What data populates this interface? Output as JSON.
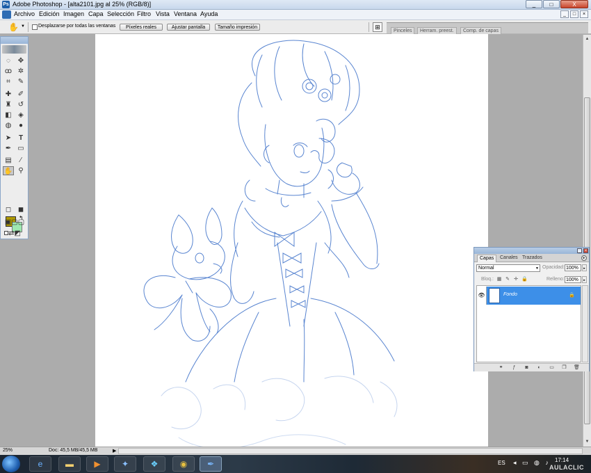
{
  "window": {
    "title": "Adobe Photoshop - [alta2101.jpg al 25% (RGB/8)]",
    "controls": [
      "_",
      "□",
      "X"
    ]
  },
  "menubar": {
    "items": [
      "Archivo",
      "Edición",
      "Imagen",
      "Capa",
      "Selección",
      "Filtro",
      "Vista",
      "Ventana",
      "Ayuda"
    ],
    "doc_controls": [
      "_",
      "□",
      "×"
    ]
  },
  "options": {
    "scroll_all_label": "Desplazarse por todas las ventanas",
    "buttons": [
      "Píxeles reales",
      "Ajustar pantalla",
      "Tamaño impresión"
    ],
    "well_tabs": [
      "Pinceles",
      "Herram. preest.",
      "Comp. de capas"
    ]
  },
  "tools": {
    "colors": {
      "foreground": "#b09a00",
      "background": "#9ee8b0"
    },
    "icons": [
      "marquee-icon",
      "move-icon",
      "lasso-icon",
      "magic-wand-icon",
      "crop-icon",
      "slice-icon",
      "healing-icon",
      "brush-icon",
      "stamp-icon",
      "history-brush-icon",
      "eraser-icon",
      "bucket-icon",
      "blur-icon",
      "dodge-icon",
      "path-select-icon",
      "type-icon",
      "pen-icon",
      "shape-icon",
      "notes-icon",
      "eyedropper-icon",
      "hand-icon",
      "zoom-icon"
    ]
  },
  "layers": {
    "tabs": [
      "Capas",
      "Canales",
      "Trazados"
    ],
    "blend_mode": "Normal",
    "opacity_label": "Opacidad:",
    "opacity": "100%",
    "lock_label": "Bloq.:",
    "fill_label": "Relleno:",
    "fill": "100%",
    "items": [
      {
        "name": "Fondo",
        "visible": true,
        "locked": true,
        "selected": true
      }
    ]
  },
  "status": {
    "zoom": "25%",
    "doc_info": "Doc: 45,5 MB/45,5 MB"
  },
  "taskbar": {
    "language": "ES",
    "time": "17:14",
    "watermark": "AULACLIC"
  }
}
